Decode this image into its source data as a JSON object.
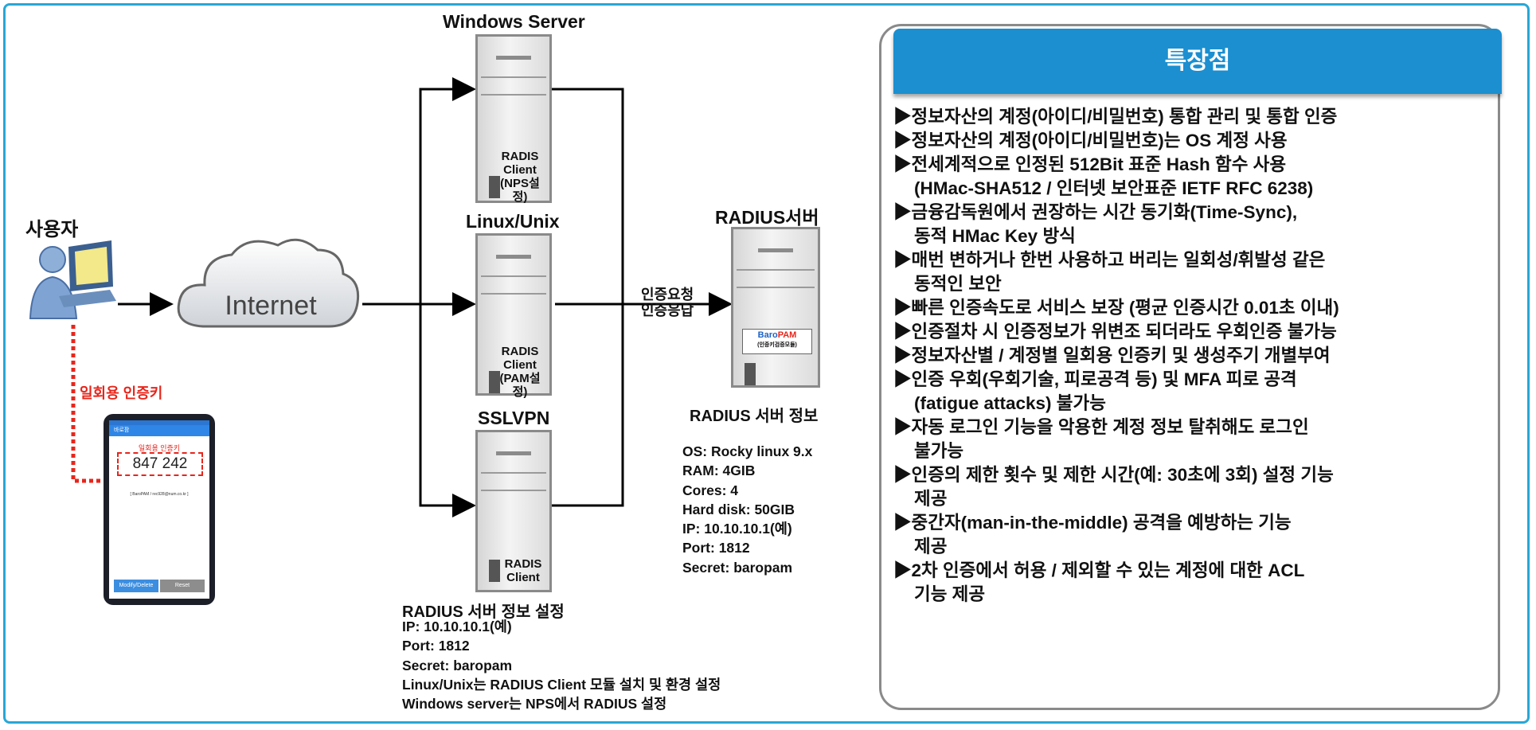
{
  "user": {
    "label": "사용자"
  },
  "otp_label": "일회용 인증키",
  "internet": {
    "label": "Internet"
  },
  "servers": {
    "windows": {
      "title": "Windows Server",
      "label": [
        "RADIS",
        "Client",
        "(NPS설정)"
      ]
    },
    "linux": {
      "title": "Linux/Unix",
      "label": [
        "RADIS",
        "Client",
        "(PAM설정)"
      ]
    },
    "sslvpn": {
      "title": "SSLVPN",
      "label": [
        "RADIS",
        "Client"
      ]
    }
  },
  "arrows": {
    "request": "인증요청",
    "response": "인증응답"
  },
  "radius": {
    "title": "RADIUS서버",
    "module_brand_a": "Baro",
    "module_brand_b": "PAM",
    "module_sub": "(인증키검증모듈)",
    "info_title": "RADIUS 서버 정보",
    "info": [
      "OS: Rocky linux 9.x",
      "RAM: 4GIB",
      "Cores: 4",
      "Hard disk: 50GIB",
      "IP: 10.10.10.1(예)",
      "Port: 1812",
      "Secret: baropam"
    ]
  },
  "client_settings": {
    "title": "RADIUS 서버 정보 설정",
    "lines": [
      "IP: 10.10.10.1(예)",
      "Port: 1812",
      "Secret: baropam",
      "Linux/Unix는 RADIUS Client 모듈 설치 및 환경 설정",
      "Windows server는 NPS에서 RADIUS 설정"
    ]
  },
  "phone": {
    "app": "바로팜",
    "heading": "일회용 인증키",
    "code": "847 242",
    "account": "[ BaroPAM / rec928@num.co.kr ]",
    "buttons": [
      "Modify/Delete",
      "Reset"
    ]
  },
  "features": {
    "header": "특장점",
    "items": [
      "▶정보자산의 계정(아이디/비밀번호) 통합 관리 및 통합 인증",
      "▶정보자산의 계정(아이디/비밀번호)는 OS 계정 사용",
      "▶전세계적으로 인정된 512Bit 표준 Hash 함수 사용",
      " (HMac-SHA512 / 인터넷 보안표준 IETF RFC 6238)",
      "▶금융감독원에서 권장하는 시간 동기화(Time-Sync),",
      " 동적 HMac Key 방식",
      "▶매번 변하거나 한번 사용하고 버리는 일회성/휘발성 같은",
      " 동적인 보안",
      "▶빠른 인증속도로 서비스 보장 (평균 인증시간 0.01초 이내)",
      "▶인증절차 시 인증정보가 위변조 되더라도 우회인증 불가능",
      "▶정보자산별 / 계정별 일회용 인증키 및 생성주기 개별부여",
      "▶인증 우회(우회기술, 피로공격 등) 및 MFA 피로 공격",
      " (fatigue attacks) 불가능",
      "▶자동 로그인 기능을 악용한 계정 정보 탈취해도 로그인",
      " 불가능",
      "▶인증의 제한 횟수 및 제한 시간(예: 30초에 3회) 설정 기능",
      " 제공",
      "▶중간자(man-in-the-middle) 공격을 예방하는 기능",
      " 제공",
      "▶2차 인증에서 허용 / 제외할 수 있는 계정에 대한 ACL",
      " 기능 제공"
    ]
  },
  "colors": {
    "frame": "#29a7d6",
    "header": "#1b8fd0",
    "otp": "#e8251b"
  }
}
